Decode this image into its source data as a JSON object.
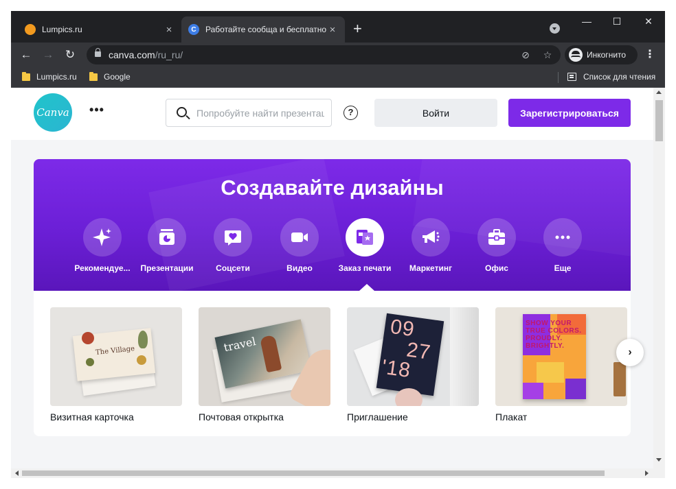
{
  "browser": {
    "tabs": [
      {
        "title": "Lumpics.ru",
        "favicon": "lumpics-favicon",
        "active": false
      },
      {
        "title": "Работайте сообща и бесплатно",
        "favicon": "canva-favicon",
        "active": true
      }
    ],
    "new_tab_icon": "+",
    "close_icon": "×",
    "window_controls": {
      "minimize": "—",
      "maximize": "☐",
      "close": "✕"
    },
    "nav": {
      "back": "←",
      "forward": "→",
      "reload": "↻"
    },
    "url_host": "canva.com",
    "url_path": "/ru_ru/",
    "tracking_icon": "⊘",
    "star_icon": "☆",
    "profile_label": "Инкогнито",
    "menu_icon": "⋮",
    "bookmarks": [
      {
        "label": "Lumpics.ru"
      },
      {
        "label": "Google"
      }
    ],
    "reading_list_label": "Список для чтения"
  },
  "site": {
    "logo_text": "Canva",
    "more_icon": "•••",
    "search_placeholder": "Попробуйте найти презентацию",
    "help_icon": "?",
    "login_label": "Войти",
    "signup_label": "Зарегистрироваться",
    "accent_color": "#7d2ae8",
    "logo_color": "#20c4cb"
  },
  "hero": {
    "title": "Создавайте дизайны",
    "categories": [
      {
        "label": "Рекомендуе...",
        "icon": "sparkle-icon"
      },
      {
        "label": "Презентации",
        "icon": "presentation-icon"
      },
      {
        "label": "Соцсети",
        "icon": "heart-chat-icon"
      },
      {
        "label": "Видео",
        "icon": "video-camera-icon"
      },
      {
        "label": "Заказ печати",
        "icon": "print-order-icon",
        "active": true
      },
      {
        "label": "Маркетинг",
        "icon": "megaphone-icon"
      },
      {
        "label": "Офис",
        "icon": "briefcase-icon"
      },
      {
        "label": "Еще",
        "icon": "more-dots-icon"
      }
    ]
  },
  "cards": [
    {
      "label": "Визитная карточка",
      "image_text": "The Village"
    },
    {
      "label": "Почтовая открытка",
      "image_text": "travel"
    },
    {
      "label": "Приглашение",
      "image_text_top": "09",
      "image_text_mid": "27",
      "image_text_bottom": "'18"
    },
    {
      "label": "Плакат",
      "image_text": "SHOW YOUR TRUE COLORS. PROUDLY. BRIGHTLY."
    }
  ],
  "next_icon": "›"
}
